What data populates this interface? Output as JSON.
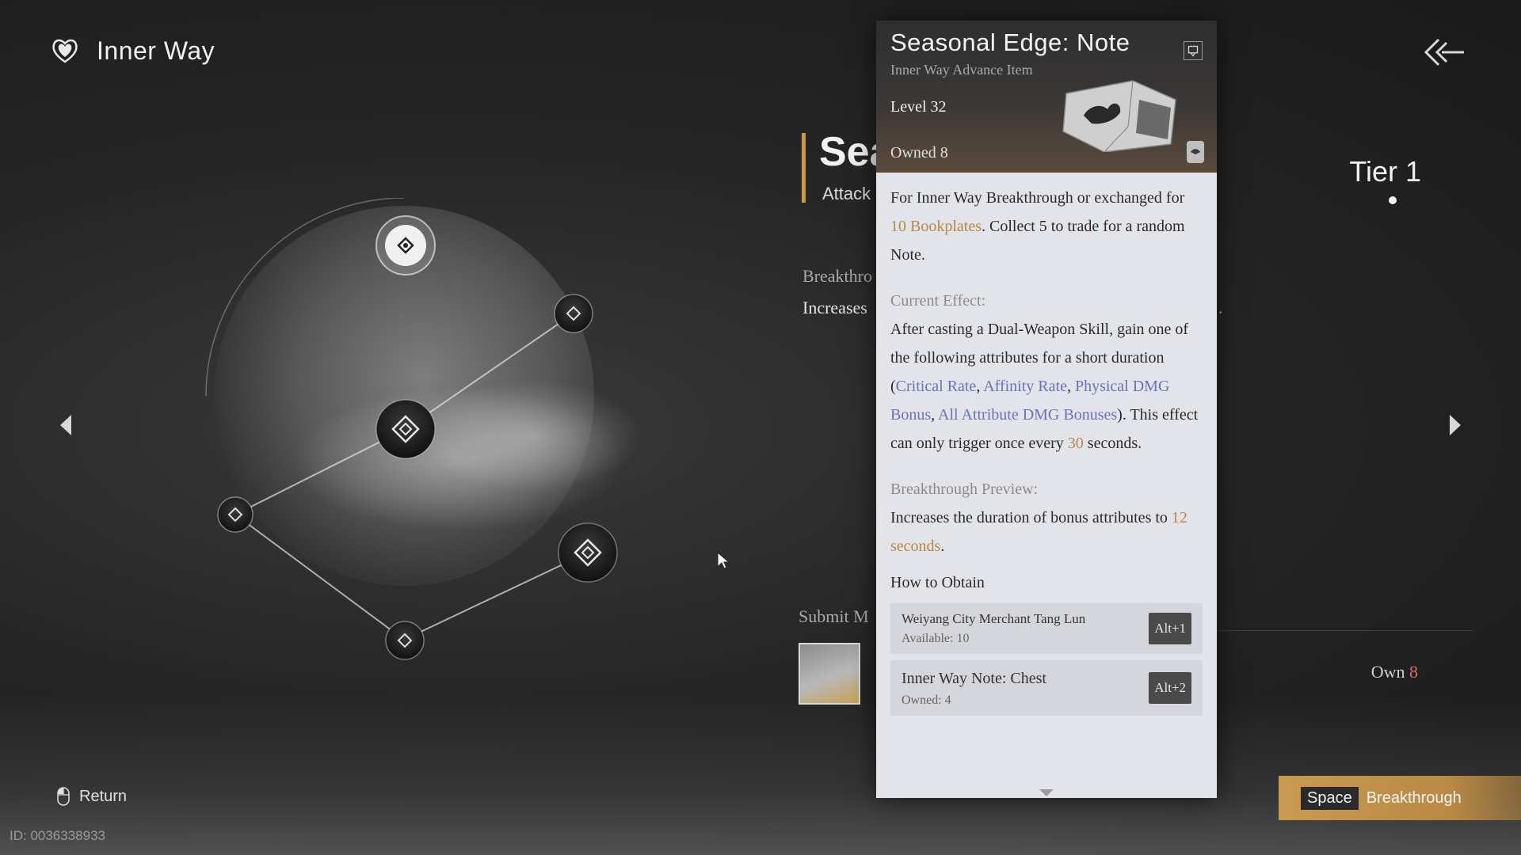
{
  "header": {
    "title": "Inner Way",
    "icon": "heart-shield-icon"
  },
  "background_panel": {
    "title_partial": "Sea",
    "subtitle_partial": "Attack",
    "breakthrough_label_partial": "Breakthro",
    "breakthrough_text_partial": "Increases",
    "period": ".",
    "submit_label_partial": "Submit M",
    "own_label": "Own",
    "own_value": "8"
  },
  "tier": {
    "label": "Tier 1"
  },
  "tooltip": {
    "title": "Seasonal Edge: Note",
    "subtitle": "Inner Way Advance Item",
    "level": "Level 32",
    "owned": "Owned 8",
    "desc": {
      "a": "For Inner Way Breakthrough or exchanged for ",
      "b": "10 Bookplates",
      "c": ". Collect 5 to trade for a random Note."
    },
    "current_effect_label": "Current Effect:",
    "effect": {
      "a": "After casting a Dual-Weapon Skill, gain one of the following attributes for a short duration (",
      "crit": "Critical Rate",
      "sep1": ", ",
      "affinity": "Affinity Rate",
      "sep2": ", ",
      "phys": "Physical DMG Bonus",
      "sep3": ", ",
      "allattr": "All Attribute DMG Bonuses",
      "b": "). This effect can only trigger once every ",
      "secs": "30",
      "c": " seconds."
    },
    "preview_label": "Breakthrough Preview:",
    "preview": {
      "a": "Increases the duration of bonus attributes to ",
      "b": "12 seconds",
      "c": "."
    },
    "how_to_obtain": "How to Obtain",
    "sources": [
      {
        "name": "Weiyang City Merchant Tang Lun",
        "meta": "Available: 10",
        "key": "Alt+1"
      },
      {
        "name": "Inner Way Note: Chest",
        "meta": "Owned: 4",
        "key": "Alt+2"
      }
    ]
  },
  "footer": {
    "return_label": "Return",
    "uid": "ID: 0036338933",
    "breakthrough_key": "Space",
    "breakthrough_label": "Breakthrough"
  },
  "colors": {
    "accent_gold": "#c79a4a",
    "link_blue": "#6a73b8",
    "value_orange": "#b5874a",
    "own_red": "#e06a6a"
  }
}
